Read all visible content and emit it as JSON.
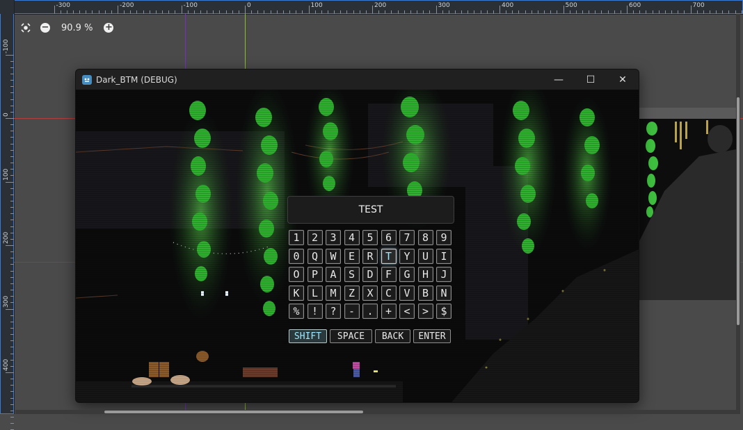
{
  "rulers": {
    "x_labels": [
      "-300",
      "-200",
      "-100",
      "0",
      "100",
      "200",
      "300",
      "400",
      "500",
      "600",
      "700"
    ],
    "y_labels": [
      "-100",
      "0",
      "100",
      "200",
      "300",
      "400"
    ]
  },
  "zoom": {
    "value": "90.9 %"
  },
  "window": {
    "title": "Dark_BTM (DEBUG)",
    "minimize": "—",
    "maximize": "☐",
    "close": "✕"
  },
  "keyboard": {
    "title": "TEST",
    "rows": [
      [
        "1",
        "2",
        "3",
        "4",
        "5",
        "6",
        "7",
        "8",
        "9"
      ],
      [
        "0",
        "Q",
        "W",
        "E",
        "R",
        "T",
        "Y",
        "U",
        "I"
      ],
      [
        "O",
        "P",
        "A",
        "S",
        "D",
        "F",
        "G",
        "H",
        "J"
      ],
      [
        "K",
        "L",
        "M",
        "Z",
        "X",
        "C",
        "V",
        "B",
        "N"
      ],
      [
        "%",
        "!",
        "?",
        "-",
        ".",
        "+",
        "<",
        ">",
        "$"
      ]
    ],
    "selected_key": "T",
    "actions": [
      "SHIFT",
      "SPACE",
      "BACK",
      "ENTER"
    ],
    "selected_action": "SHIFT"
  },
  "colors": {
    "guide_purple": "#8a2be2",
    "guide_green": "#9acd32",
    "guide_red": "#c0392b",
    "foliage": "#3bd13b",
    "highlight": "#9fe7ff"
  }
}
